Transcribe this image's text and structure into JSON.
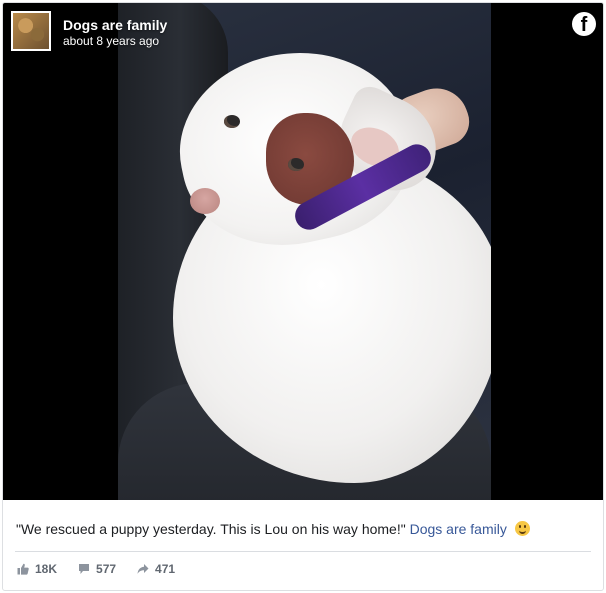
{
  "post": {
    "page_name": "Dogs are family",
    "timestamp": "about 8 years ago",
    "caption_text": "\"We rescued a puppy yesterday. This is Lou on his way home!\"",
    "caption_link": "Dogs are family",
    "caption_emoji": "smiley-face-icon",
    "stats": {
      "likes": "18K",
      "comments": "577",
      "shares": "471"
    }
  },
  "icons": {
    "brand": "facebook-logo-icon",
    "like": "thumbs-up-icon",
    "comment": "comment-icon",
    "share": "share-arrow-icon"
  },
  "colors": {
    "link": "#385898",
    "text": "#1c1e21",
    "muted": "#606770",
    "media_background": "#000000"
  }
}
